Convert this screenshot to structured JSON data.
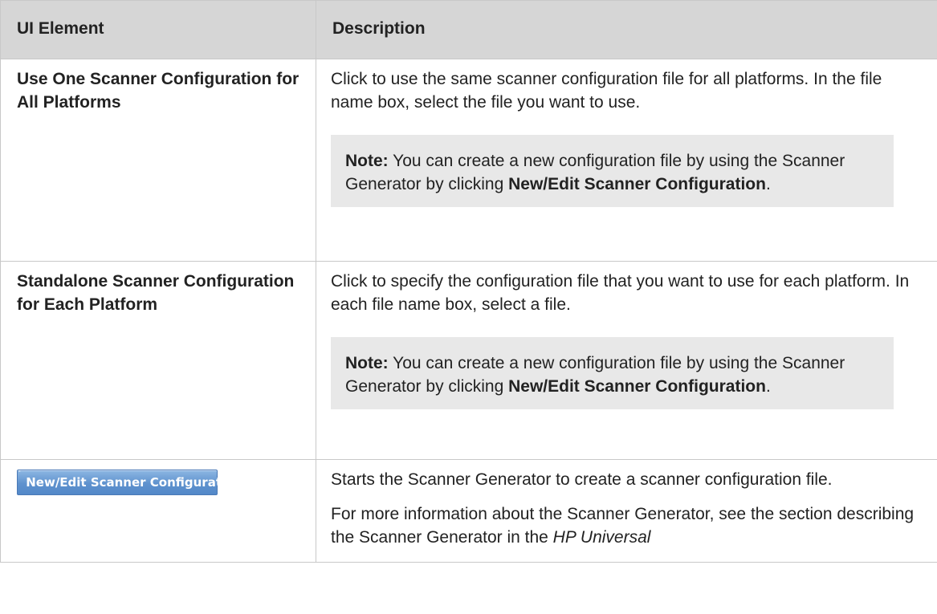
{
  "table": {
    "header": {
      "col_element": "UI Element",
      "col_description": "Description"
    },
    "rows": [
      {
        "element": "Use One Scanner Configuration for All Platforms",
        "description": "Click to use the same scanner configuration file for all platforms. In the file name box, select the file you want to use.",
        "note": {
          "label": "Note:",
          "text": " You can create a new configuration file by using the Scanner Generator by clicking ",
          "bold": "New/Edit Scanner Configuration",
          "tail": "."
        }
      },
      {
        "element": "Standalone Scanner Configuration for Each Platform",
        "description": "Click to specify the configuration file that you want to use for each platform. In each file name box, select a file.",
        "note": {
          "label": "Note:",
          "text": " You can create a new configuration file by using the Scanner Generator by clicking ",
          "bold": "New/Edit Scanner Configuration",
          "tail": "."
        }
      },
      {
        "button_label": "New/Edit Scanner Configuration...",
        "description": "Starts the Scanner Generator to create a scanner configuration file.",
        "more_info": {
          "text": "For more information about the Scanner Generator, see the section describing the Scanner Generator in the ",
          "italic": "HP Universal"
        }
      }
    ]
  },
  "colors": {
    "header_bg": "#d6d6d6",
    "note_bg": "#e8e8e8",
    "border": "#c8c8c8",
    "button_blue": "#5f92ce"
  }
}
